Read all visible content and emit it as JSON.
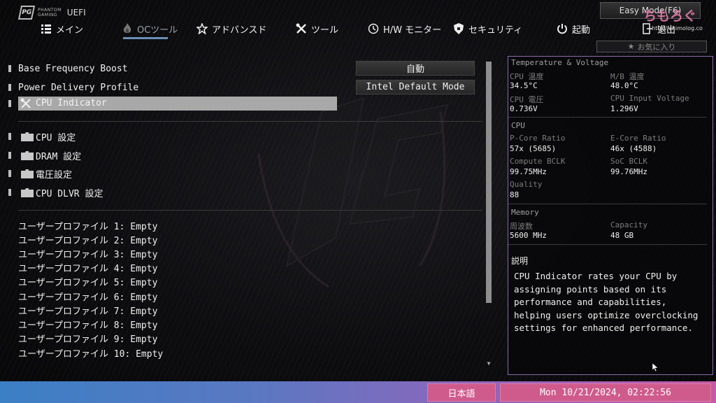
{
  "brand": {
    "line1": "PHANTOM",
    "line2": "GAMING",
    "uefi": "UEFI",
    "mark": "PG"
  },
  "easy_mode": "Easy Mode(F6)",
  "watermark": {
    "text": "ちもろぐ",
    "url": "http://chimolog.co"
  },
  "nav": [
    {
      "label": "メイン",
      "icon": "list-icon"
    },
    {
      "label": "OCツール",
      "icon": "oc-flame-icon",
      "active": true
    },
    {
      "label": "アドバンスド",
      "icon": "star-icon"
    },
    {
      "label": "ツール",
      "icon": "tools-icon"
    },
    {
      "label": "H/W モニター",
      "icon": "monitor-icon"
    },
    {
      "label": "セキュリティ",
      "icon": "shield-icon"
    },
    {
      "label": "起動",
      "icon": "power-icon"
    },
    {
      "label": "退出",
      "icon": "exit-icon"
    }
  ],
  "favorites": {
    "label": "お気に入り",
    "icon": "star-icon"
  },
  "settings": [
    {
      "label": "Base Frequency Boost",
      "value": "自動"
    },
    {
      "label": "Power Delivery Profile",
      "value": "Intel Default Mode"
    }
  ],
  "selected_item": "CPU Indicator",
  "folders": [
    "CPU 設定",
    "DRAM 設定",
    "電圧設定",
    "CPU DLVR 設定"
  ],
  "profiles": [
    "ユーザープロファイル 1: Empty",
    "ユーザープロファイル 2: Empty",
    "ユーザープロファイル 3: Empty",
    "ユーザープロファイル 4: Empty",
    "ユーザープロファイル 5: Empty",
    "ユーザープロファイル 6: Empty",
    "ユーザープロファイル 7: Empty",
    "ユーザープロファイル 8: Empty",
    "ユーザープロファイル 9: Empty",
    "ユーザープロファイル 10: Empty"
  ],
  "info": {
    "tv_title": "Temperature & Voltage",
    "cpu_temp_label": "CPU 温度",
    "cpu_temp": "34.5°C",
    "mb_temp_label": "M/B 温度",
    "mb_temp": "48.0°C",
    "cpu_volt_label": "CPU 電圧",
    "cpu_volt": "0.736V",
    "cpu_input_label": "CPU Input Voltage",
    "cpu_input": "1.296V",
    "cpu_title": "CPU",
    "pcore_label": "P-Core Ratio",
    "pcore": "57x (5685)",
    "ecore_label": "E-Core Ratio",
    "ecore": "46x (4588)",
    "cbclk_label": "Compute BCLK",
    "cbclk": "99.75MHz",
    "socbclk_label": "SoC BCLK",
    "socbclk": "99.76MHz",
    "quality_label": "Quality",
    "quality": "88",
    "mem_title": "Memory",
    "freq_label": "周波数",
    "freq": "5600 MHz",
    "cap_label": "Capacity",
    "cap": "48 GB",
    "desc_title": "説明",
    "desc": "CPU Indicator rates your CPU by assigning points based on its performance and capabilities, helping users optimize overclocking settings for enhanced performance."
  },
  "bottom": {
    "language": "日本語",
    "datetime": "Mon 10/21/2024, 02:22:56"
  },
  "colors": {
    "accent_blue": "#3c7fc4",
    "accent_pink": "#cf5b8c",
    "panel_border": "#8a6aa8"
  }
}
